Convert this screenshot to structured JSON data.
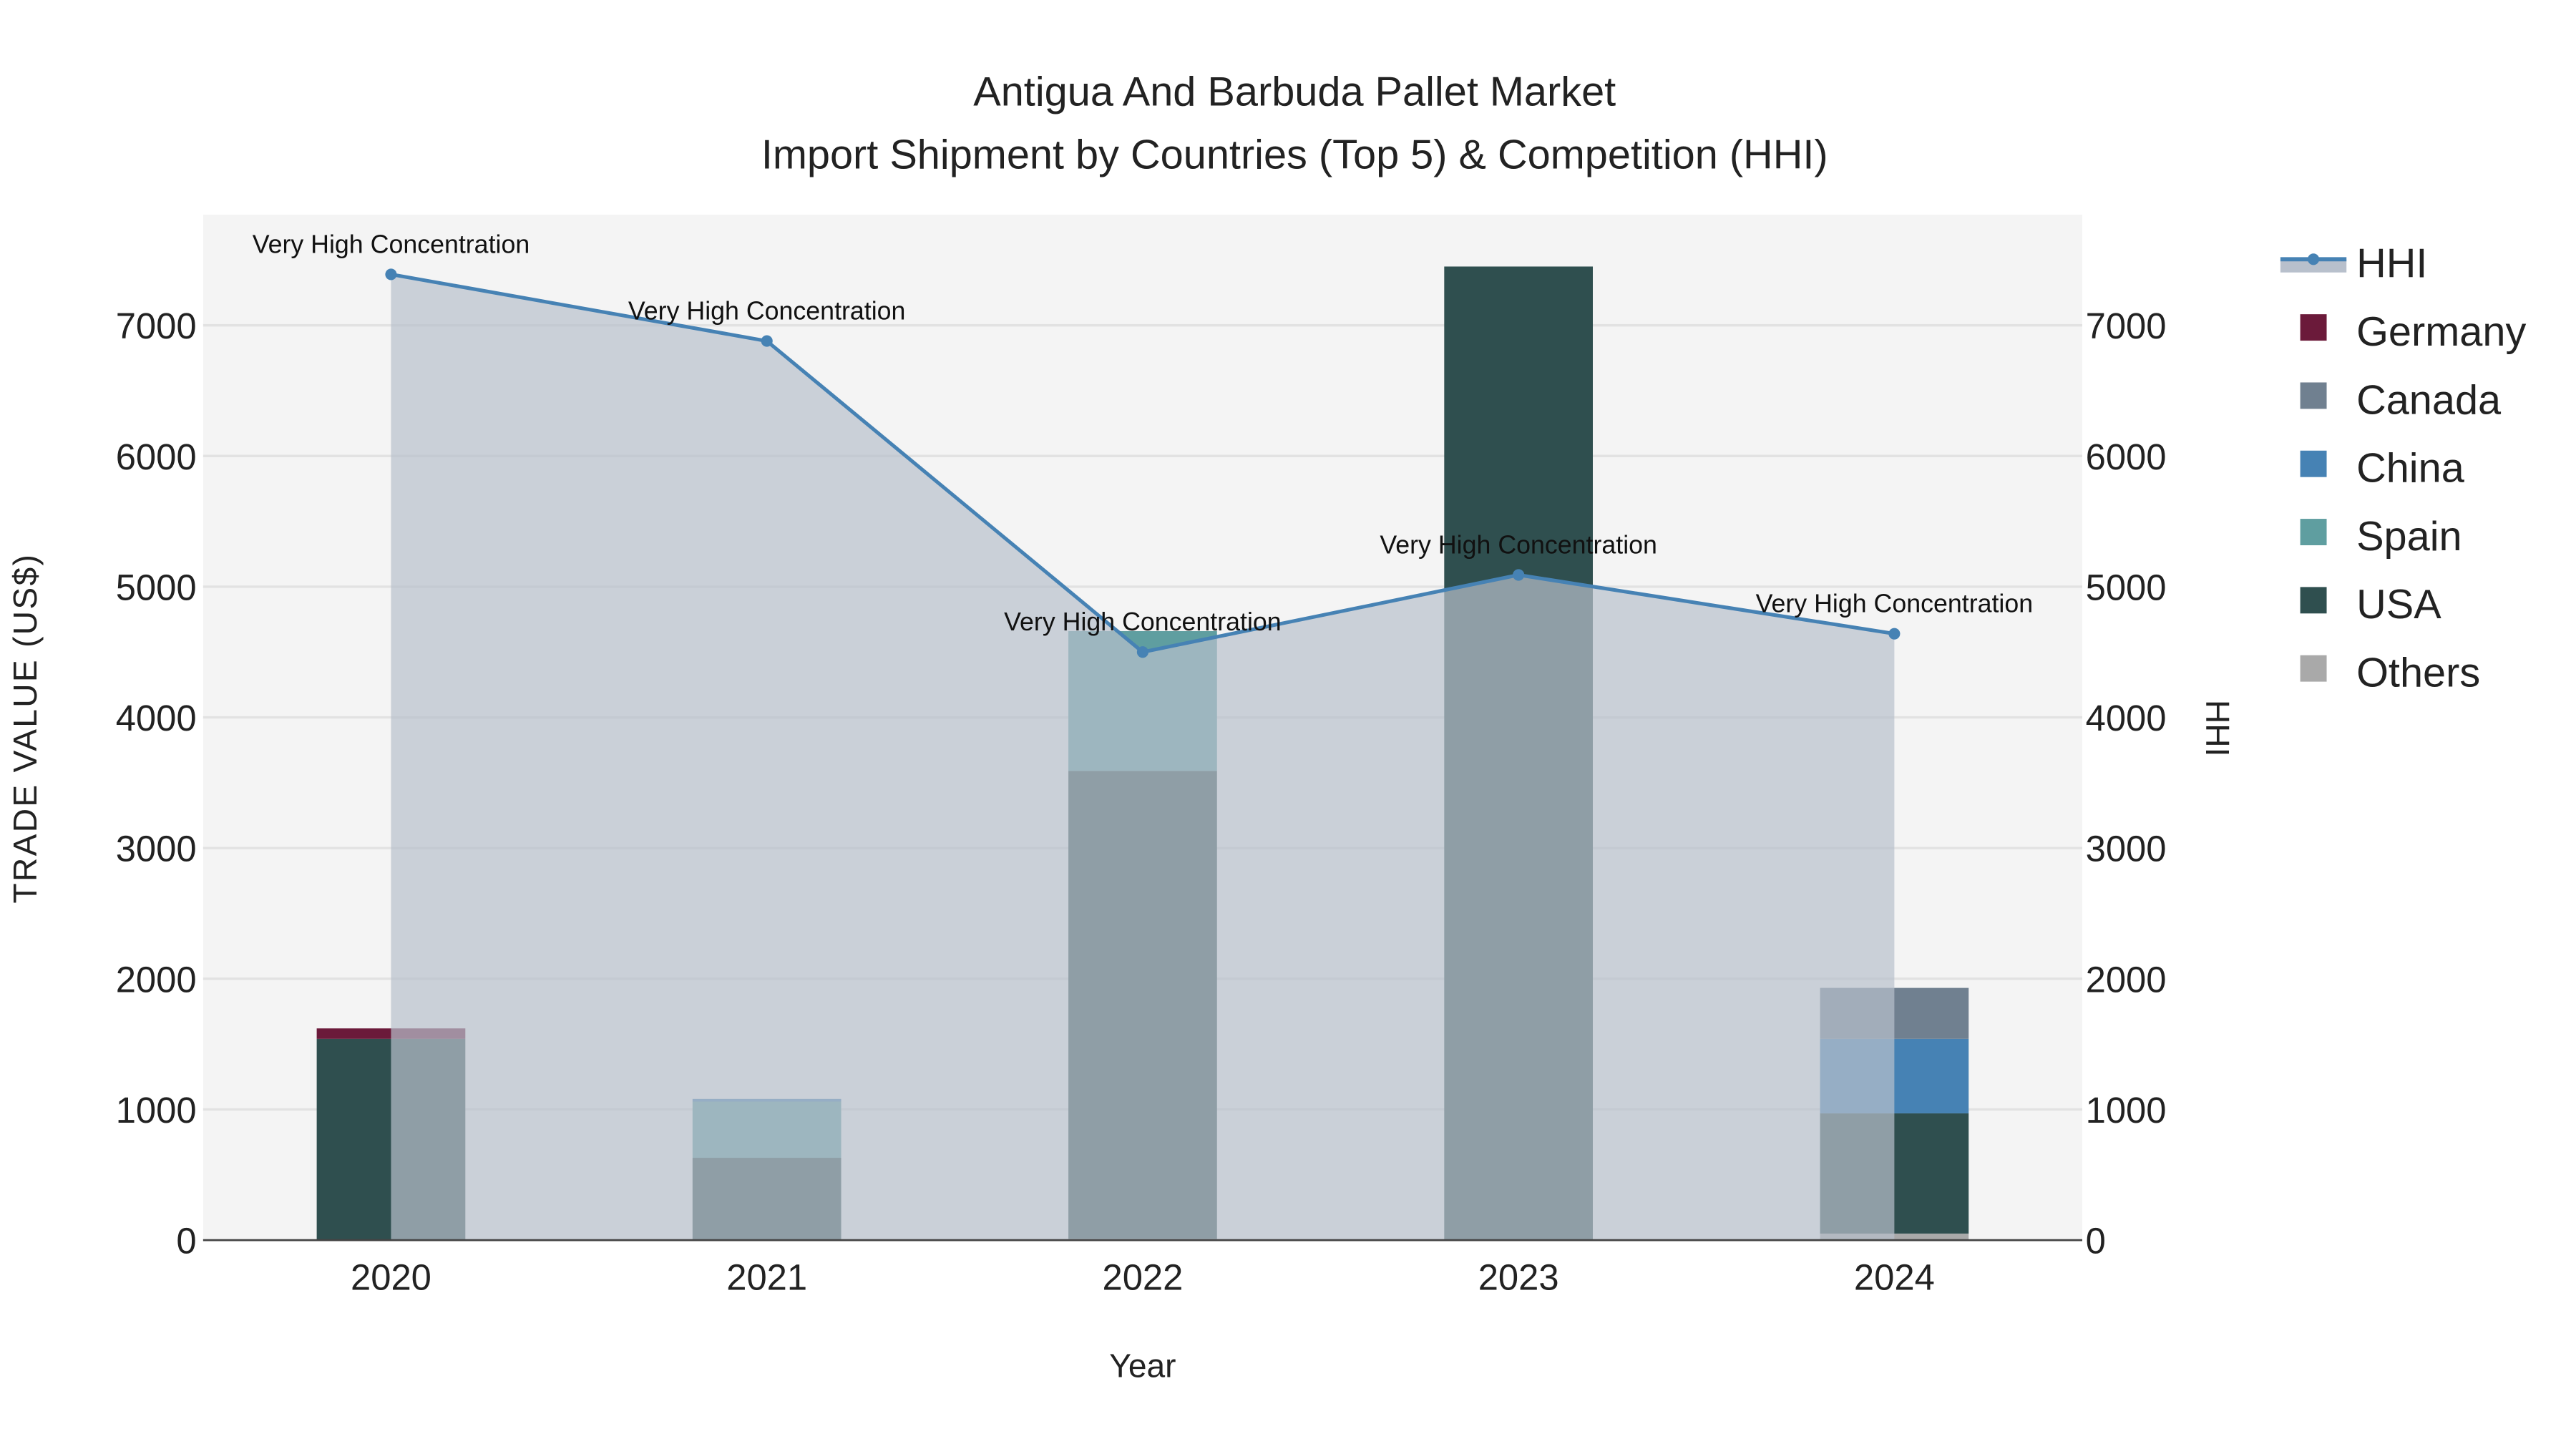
{
  "chart_data": {
    "type": "bar",
    "title": "Antigua And Barbuda Pallet Market",
    "subtitle": "Import Shipment by Countries (Top 5) & Competition (HHI)",
    "xlabel": "Year",
    "ylabel": "TRADE VALUE (US$)",
    "y2label": "HHI",
    "ylim": [
      0,
      7800
    ],
    "y2lim": [
      0,
      7800
    ],
    "yticks": [
      0,
      1000,
      2000,
      3000,
      4000,
      5000,
      6000,
      7000
    ],
    "categories": [
      "2020",
      "2021",
      "2022",
      "2023",
      "2024"
    ],
    "stacked": true,
    "series": [
      {
        "name": "Others",
        "color": "#a9a9a9",
        "values": [
          0,
          0,
          10,
          0,
          50
        ]
      },
      {
        "name": "USA",
        "color": "#2f4f4f",
        "values": [
          1540,
          630,
          3580,
          7450,
          920
        ]
      },
      {
        "name": "Spain",
        "color": "#5f9ea0",
        "values": [
          0,
          430,
          1070,
          0,
          0
        ]
      },
      {
        "name": "China",
        "color": "#4682b4",
        "values": [
          0,
          20,
          0,
          0,
          570
        ]
      },
      {
        "name": "Canada",
        "color": "#708090",
        "values": [
          0,
          0,
          0,
          0,
          390
        ]
      },
      {
        "name": "Germany",
        "color": "#6b1a3a",
        "values": [
          80,
          0,
          0,
          0,
          0
        ]
      }
    ],
    "hhi": {
      "name": "HHI",
      "color": "#4682b4",
      "values": [
        7390,
        6880,
        4500,
        5090,
        4640
      ],
      "labels": [
        "Very High Concentration",
        "Very High Concentration",
        "Very High Concentration",
        "Very High Concentration",
        "Very High Concentration"
      ]
    },
    "legend": [
      "HHI",
      "Germany",
      "Canada",
      "China",
      "Spain",
      "USA",
      "Others"
    ],
    "legend_position": "right",
    "grid": true
  }
}
